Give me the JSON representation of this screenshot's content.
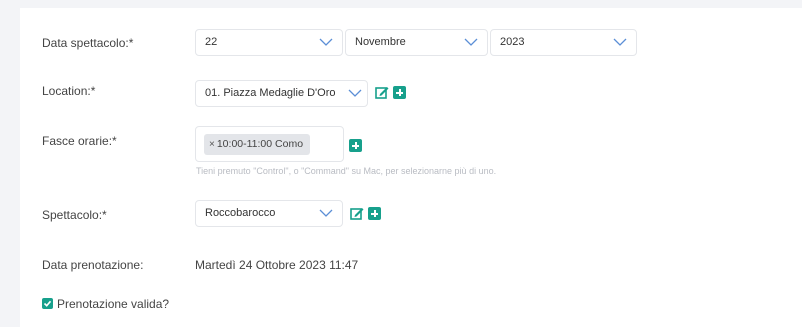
{
  "form": {
    "data_spettacolo": {
      "label": "Data spettacolo:*",
      "day": "22",
      "month": "Novembre",
      "year": "2023"
    },
    "location": {
      "label": "Location:*",
      "value": "01. Piazza Medaglie D'Oro"
    },
    "fasce_orarie": {
      "label": "Fasce orarie:*",
      "selected_tag": "10:00-11:00 Como",
      "tag_remove": "×",
      "help": "Tieni premuto \"Control\", o \"Command\" su Mac, per selezionarne più di uno."
    },
    "spettacolo": {
      "label": "Spettacolo:*",
      "value": "Roccobarocco"
    },
    "data_prenotazione": {
      "label": "Data prenotazione:",
      "value": "Martedì 24 Ottobre 2023 11:47"
    },
    "prenotazione_valida": {
      "label": "Prenotazione valida?",
      "checked": true
    }
  },
  "icons": {
    "edit": "edit-icon",
    "add": "plus-icon",
    "chevron": "chevron-down-icon",
    "check": "checkbox-checked-icon"
  },
  "colors": {
    "accent": "#17a08c",
    "border": "#e4e6ea",
    "background": "#f3f4f7"
  }
}
